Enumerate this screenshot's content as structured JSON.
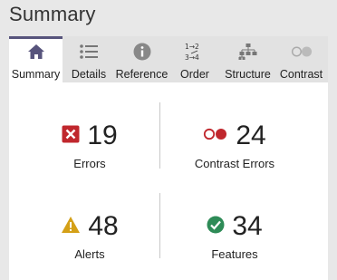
{
  "header": {
    "title": "Summary"
  },
  "tabs": [
    {
      "label": "Summary",
      "icon": "home-icon",
      "active": true
    },
    {
      "label": "Details",
      "icon": "list-icon"
    },
    {
      "label": "Reference",
      "icon": "info-icon"
    },
    {
      "label": "Order",
      "icon": "order-icon"
    },
    {
      "label": "Structure",
      "icon": "structure-icon"
    },
    {
      "label": "Contrast",
      "icon": "contrast-icon"
    }
  ],
  "stats": {
    "errors": {
      "value": "19",
      "label": "Errors",
      "icon": "error-icon",
      "color": "#c0272d"
    },
    "contrast_errors": {
      "value": "24",
      "label": "Contrast Errors",
      "icon": "contrast-error-icon",
      "color": "#c0272d"
    },
    "alerts": {
      "value": "48",
      "label": "Alerts",
      "icon": "alert-icon",
      "color": "#d4a017"
    },
    "features": {
      "value": "34",
      "label": "Features",
      "icon": "feature-check-icon",
      "color": "#2e8b57"
    }
  },
  "colors": {
    "accent": "#57547c",
    "tab_bg": "#e2e2e2",
    "panel_bg": "#ffffff"
  }
}
